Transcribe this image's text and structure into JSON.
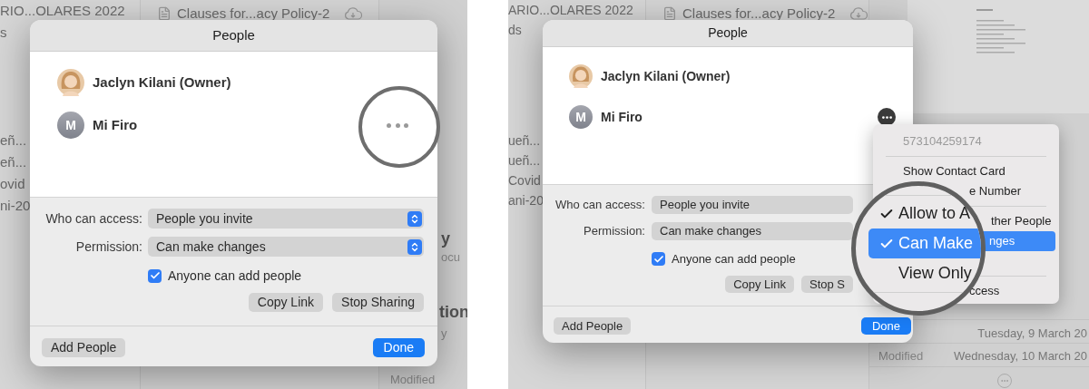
{
  "screenshots": [
    {
      "kind": "before",
      "sidebar_top": [
        "RIO...OLARES 2022",
        "s"
      ],
      "sidebar_bottom": [
        "eñ...",
        "eñ...",
        "ovid",
        "ni-20"
      ],
      "file": "Clauses for...acy Policy-2",
      "info": [
        {
          "kind": "heading",
          "text": "y"
        },
        {
          "kind": "caption",
          "text": "ocu"
        },
        {
          "kind": "heading",
          "text": "tion"
        },
        {
          "kind": "caption",
          "text": "y"
        },
        {
          "kind": "caption",
          "text": "Modified"
        }
      ],
      "dialog": {
        "title": "People",
        "people": [
          {
            "kind": "photo",
            "name": "Jaclyn Kilani (Owner)"
          },
          {
            "kind": "initials",
            "name": "Mi Firo",
            "initials": "M"
          }
        ],
        "more_button": {
          "kind": "plain"
        },
        "access": {
          "label": "Who can access:",
          "value": "People you invite"
        },
        "permission": {
          "label": "Permission:",
          "value": "Can make changes"
        },
        "select_arrows": true,
        "anyone_can_add": {
          "label": "Anyone can add people",
          "checked": true
        },
        "link_buttons": [
          "Copy Link",
          "Stop Sharing"
        ],
        "add_button": "Add People",
        "done_button": "Done"
      },
      "magnifier": {
        "kind": "ring"
      }
    },
    {
      "kind": "after",
      "sidebar_top": [
        "ARIO...OLARES 2022",
        "ds"
      ],
      "sidebar_bottom": [
        "ueñ...",
        "ueñ...",
        "Covid",
        "ani-20"
      ],
      "file": "Clauses for...acy Policy-2",
      "info": [
        {
          "kind": "date",
          "text": "Tuesday, 9 March 20"
        },
        {
          "kind": "caption",
          "text": "Modified"
        },
        {
          "kind": "date",
          "text": "Wednesday, 10 March 20"
        }
      ],
      "dialog": {
        "title": "People",
        "people": [
          {
            "kind": "photo",
            "name": "Jaclyn Kilani (Owner)"
          },
          {
            "kind": "initials",
            "name": "Mi Firo",
            "initials": "M"
          }
        ],
        "more_button": {
          "kind": "filled"
        },
        "access": {
          "label": "Who can access:",
          "value": "People you invite"
        },
        "permission": {
          "label": "Permission:",
          "value": "Can make changes"
        },
        "select_arrows": false,
        "anyone_can_add": {
          "label": "Anyone can add people",
          "checked": true
        },
        "link_buttons": [
          "Copy Link",
          "Stop S"
        ],
        "add_button": "Add People",
        "done_button": "Done"
      },
      "menu": [
        {
          "kind": "caption",
          "label": "573104259174"
        },
        {
          "kind": "divider"
        },
        {
          "kind": "item",
          "label": "Show Contact Card",
          "selected": false
        },
        {
          "kind": "item",
          "label": "e Number",
          "selected": false
        },
        {
          "kind": "divider"
        },
        {
          "kind": "item",
          "label": "ther People",
          "selected": false
        },
        {
          "kind": "item",
          "label": "nges",
          "selected": true
        },
        {
          "kind": "divider"
        },
        {
          "kind": "item",
          "label": "ccess",
          "selected": false
        }
      ],
      "magnifier": {
        "kind": "lens",
        "items": [
          {
            "label": "Allow to A",
            "checked": true,
            "selected": false
          },
          {
            "label": "Can Make",
            "checked": true,
            "selected": true
          },
          {
            "label": "View Only",
            "checked": false,
            "selected": false
          }
        ]
      }
    }
  ]
}
